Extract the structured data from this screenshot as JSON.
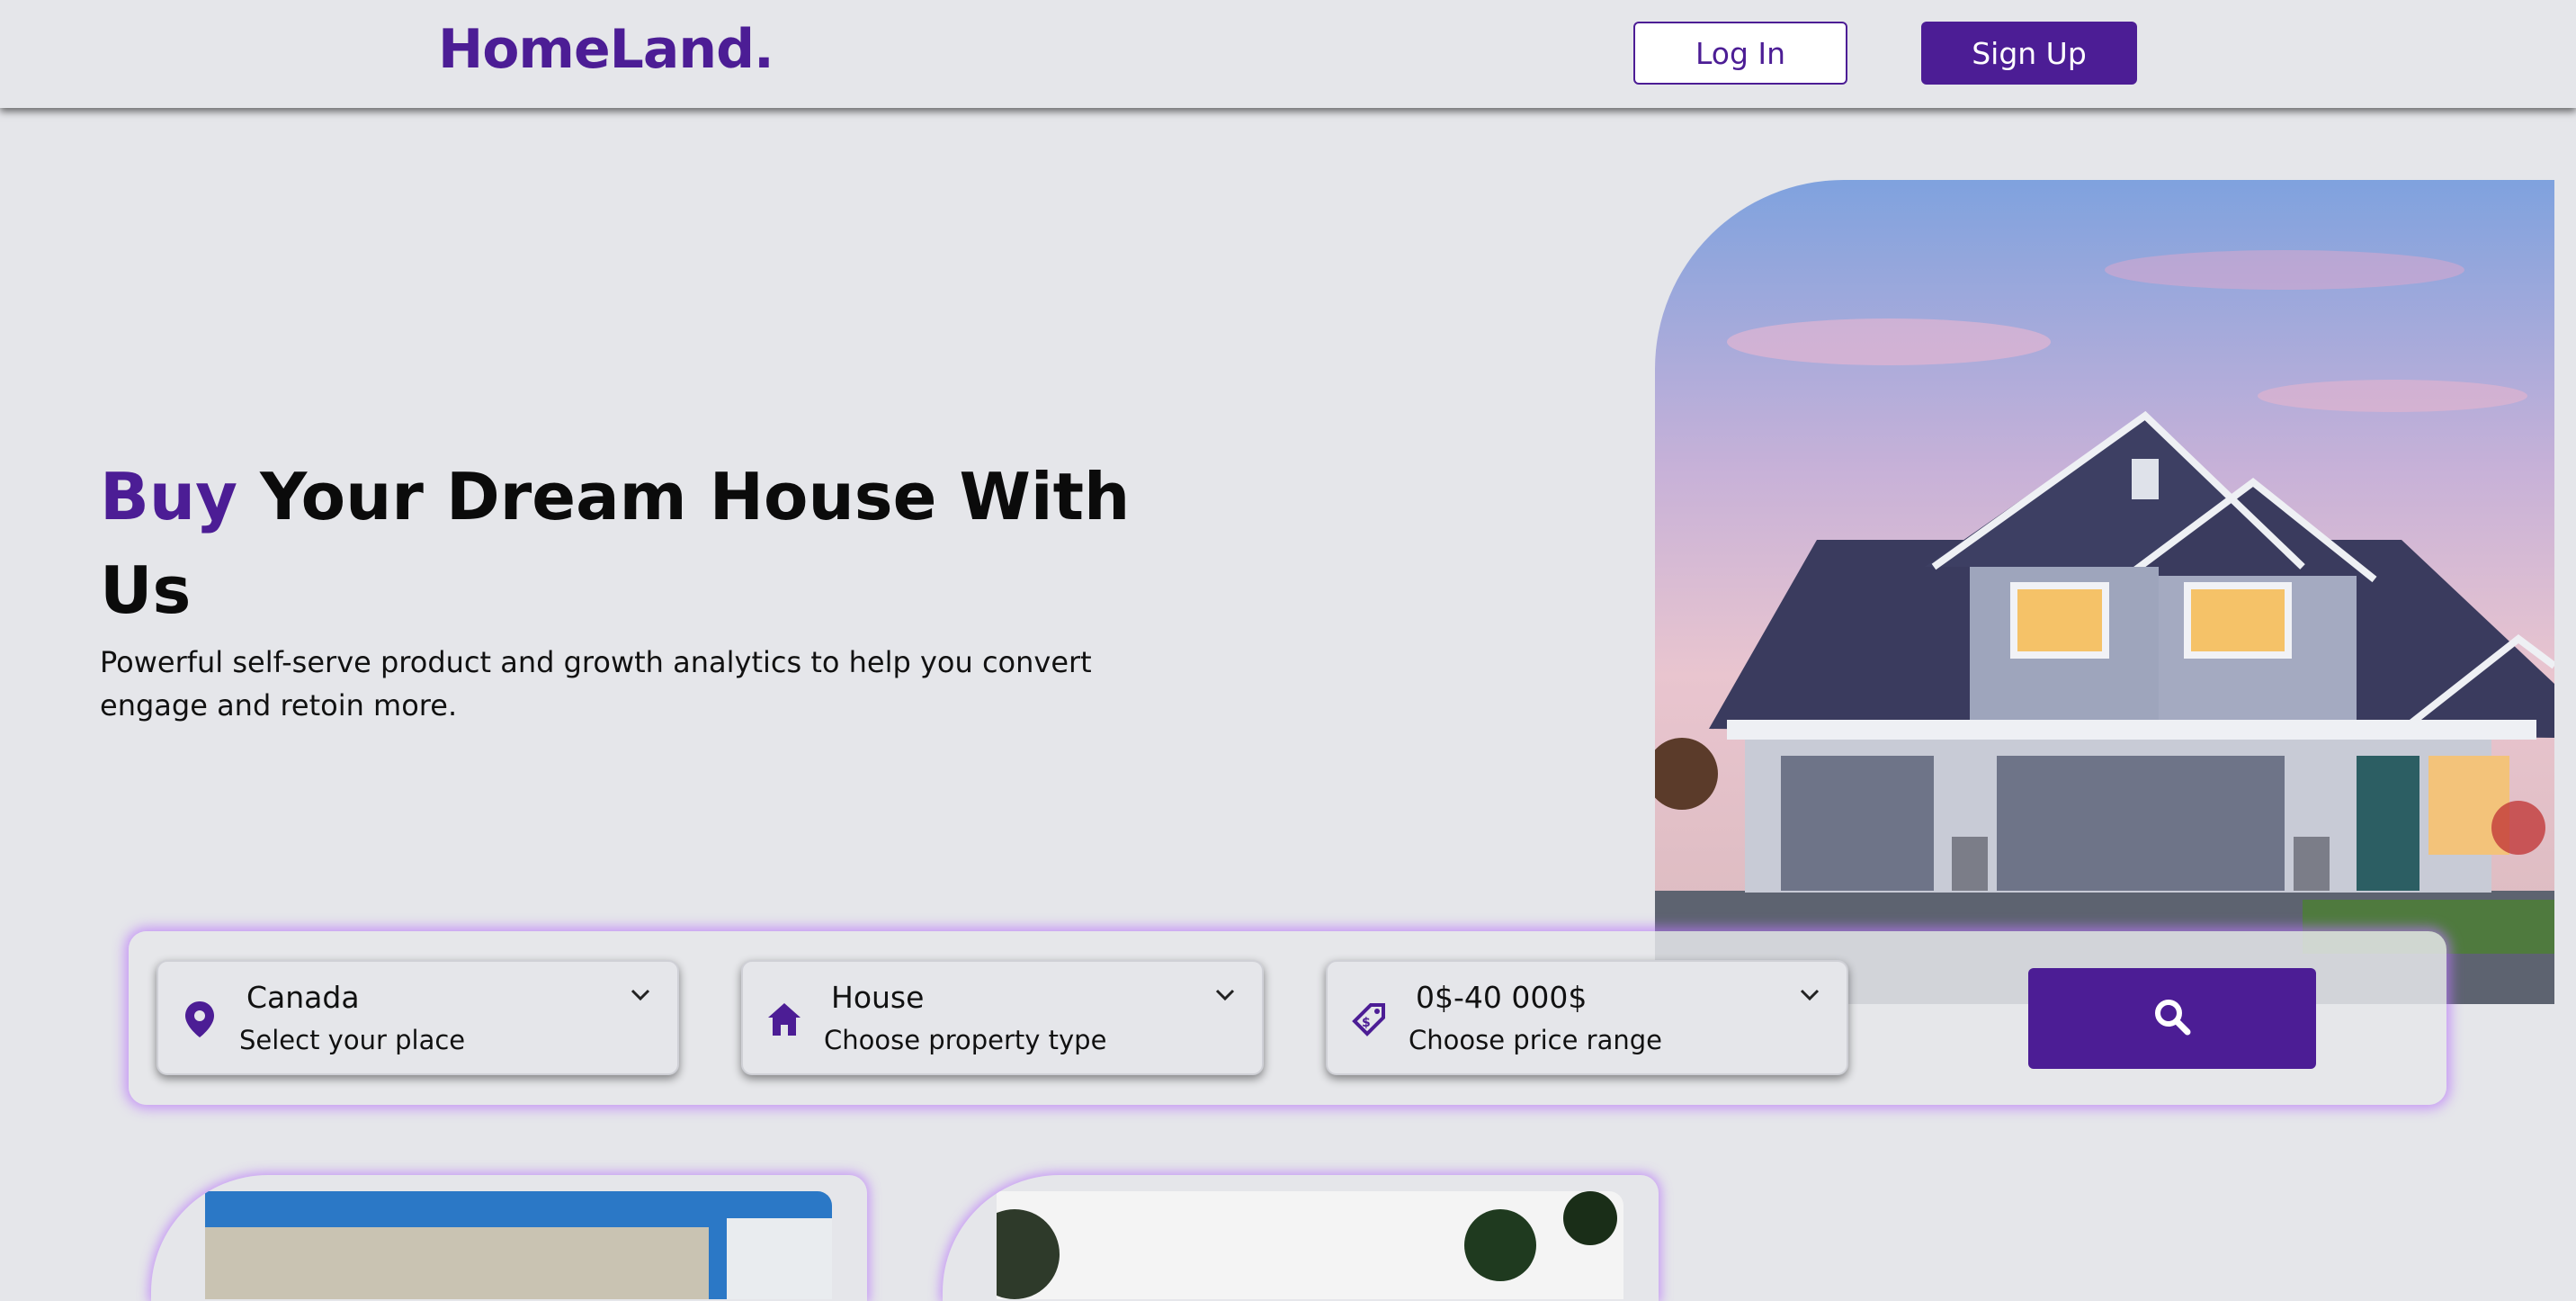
{
  "brand": {
    "logo": "HomeLand."
  },
  "nav": {
    "login_label": "Log In",
    "signup_label": "Sign Up"
  },
  "hero": {
    "title_accent": "Buy",
    "title_rest": "Your Dream House With Us",
    "subtitle": "Powerful self-serve product and growth analytics to help you convert engage and retoin more."
  },
  "search": {
    "filters": [
      {
        "value": "Canada",
        "label": "Select your place",
        "icon": "location-pin-icon"
      },
      {
        "value": "House",
        "label": "Choose property type",
        "icon": "house-icon"
      },
      {
        "value": "0$-40 000$",
        "label": "Choose price range",
        "icon": "price-tag-icon"
      }
    ],
    "button_icon": "search-icon"
  },
  "colors": {
    "brand": "#4c1d95",
    "background": "#e5e6ea",
    "glow": "#b978fa"
  }
}
